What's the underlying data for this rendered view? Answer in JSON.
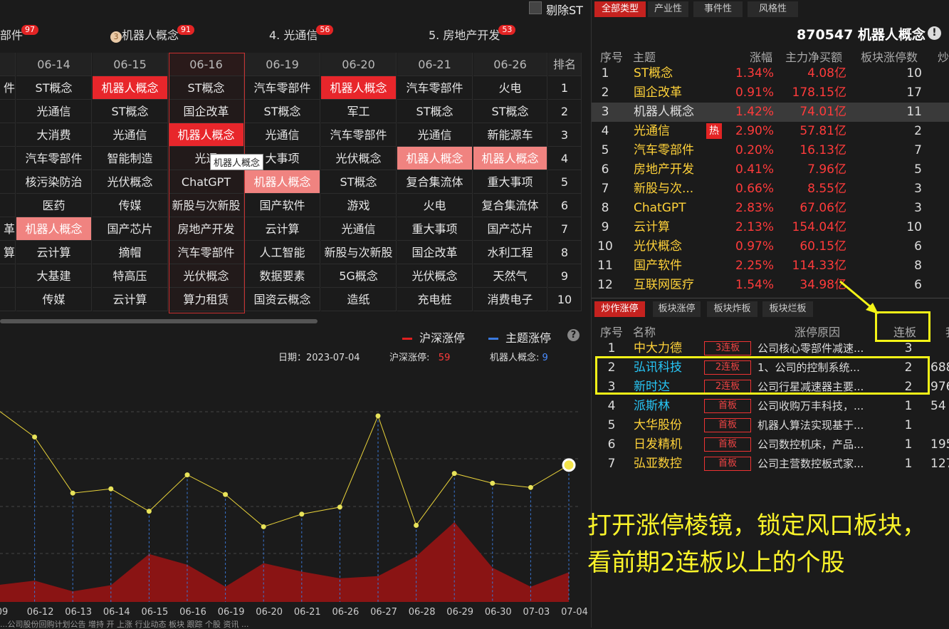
{
  "top_ranks": [
    {
      "label": "部件",
      "badge": "97"
    },
    {
      "label": "机器人概念",
      "badge": "91",
      "icon": "3"
    },
    {
      "label": "4. 光通信",
      "badge": "56"
    },
    {
      "label": "5. 房地产开发",
      "badge": "53"
    }
  ],
  "checkbox_label": "剔除ST",
  "grid": {
    "dates": [
      "06-14",
      "06-15",
      "06-16",
      "06-19",
      "06-20",
      "06-21",
      "06-26"
    ],
    "rank_header": "排名",
    "left_partial": [
      "",
      "件",
      "",
      "",
      "",
      "",
      "",
      "革",
      "算",
      "",
      ""
    ],
    "rows": [
      [
        "ST概念",
        "机器人概念",
        "ST概念",
        "汽车零部件",
        "机器人概念",
        "汽车零部件",
        "火电",
        "1"
      ],
      [
        "光通信",
        "ST概念",
        "国企改革",
        "ST概念",
        "军工",
        "ST概念",
        "ST概念",
        "2"
      ],
      [
        "大消费",
        "光通信",
        "机器人概念",
        "光通信",
        "汽车零部件",
        "光通信",
        "新能源车",
        "3"
      ],
      [
        "汽车零部件",
        "智能制造",
        "光通",
        "大事项",
        "光伏概念",
        "机器人概念",
        "机器人概念",
        "4"
      ],
      [
        "核污染防治",
        "光伏概念",
        "ChatGPT",
        "机器人概念",
        "ST概念",
        "复合集流体",
        "重大事项",
        "5"
      ],
      [
        "医药",
        "传媒",
        "新股与次新股",
        "国产软件",
        "游戏",
        "火电",
        "复合集流体",
        "6"
      ],
      [
        "机器人概念",
        "国产芯片",
        "房地产开发",
        "云计算",
        "光通信",
        "重大事项",
        "国产芯片",
        "7"
      ],
      [
        "云计算",
        "摘帽",
        "汽车零部件",
        "人工智能",
        "新股与次新股",
        "国企改革",
        "水利工程",
        "8"
      ],
      [
        "大基建",
        "特高压",
        "光伏概念",
        "数据要素",
        "5G概念",
        "光伏概念",
        "天然气",
        "9"
      ],
      [
        "传媒",
        "云计算",
        "算力租赁",
        "国资云概念",
        "造纸",
        "充电桩",
        "消费电子",
        "10"
      ]
    ],
    "tooltip": "机器人概念"
  },
  "chart_legend": {
    "a": "沪深涨停",
    "b": "主题涨停"
  },
  "chart_info": {
    "date_label": "日期：",
    "date": "2023-07-04",
    "hs_label": "沪深涨停:",
    "hs_value": "59",
    "theme_label": "机器人概念:",
    "theme_value": "9"
  },
  "chart_data": {
    "type": "line",
    "x": [
      "09",
      "06-12",
      "06-13",
      "06-14",
      "06-15",
      "06-16",
      "06-19",
      "06-20",
      "06-21",
      "06-26",
      "06-27",
      "06-28",
      "06-29",
      "06-30",
      "07-03",
      "07-04"
    ],
    "series": [
      {
        "name": "主题涨停",
        "values": [
          13,
          11,
          7,
          7.3,
          5.7,
          8.3,
          6.9,
          4.6,
          5.5,
          6,
          12.5,
          4.7,
          8.4,
          7.7,
          7.4,
          9
        ]
      },
      {
        "name": "沪深涨停",
        "values": [
          22,
          28,
          14,
          22,
          63,
          49,
          20,
          51,
          40,
          31,
          34,
          60,
          105,
          45,
          20,
          39
        ]
      }
    ]
  },
  "right": {
    "tabs": [
      "全部类型",
      "产业性",
      "事件性",
      "风格性"
    ],
    "title": "870547 机器人概念",
    "headers": [
      "序号",
      "主题",
      "涨幅",
      "主力净买额",
      "板块涨停数",
      "炒"
    ],
    "rows": [
      [
        "1",
        "ST概念",
        "1.34%",
        "4.08亿",
        "10"
      ],
      [
        "2",
        "国企改革",
        "0.91%",
        "178.15亿",
        "17"
      ],
      [
        "3",
        "机器人概念",
        "1.42%",
        "74.01亿",
        "11"
      ],
      [
        "4",
        "光通信",
        "2.90%",
        "57.81亿",
        "2"
      ],
      [
        "5",
        "汽车零部件",
        "0.20%",
        "16.13亿",
        "7"
      ],
      [
        "6",
        "房地产开发",
        "0.41%",
        "7.96亿",
        "5"
      ],
      [
        "7",
        "新股与次...",
        "0.66%",
        "8.55亿",
        "3"
      ],
      [
        "8",
        "ChatGPT",
        "2.83%",
        "67.06亿",
        "3"
      ],
      [
        "9",
        "云计算",
        "2.13%",
        "154.04亿",
        "10"
      ],
      [
        "10",
        "光伏概念",
        "0.97%",
        "60.15亿",
        "6"
      ],
      [
        "11",
        "国产软件",
        "2.25%",
        "114.33亿",
        "8"
      ],
      [
        "12",
        "互联网医疗",
        "1.54%",
        "34.98亿",
        "6"
      ]
    ],
    "hot_label": "热",
    "tabs2": [
      "炒作涨停",
      "板块涨停",
      "板块炸板",
      "板块烂板"
    ],
    "headers2": [
      "序号",
      "名称",
      "涨停原因",
      "连板",
      "我"
    ],
    "stocks": [
      [
        "1",
        "中大力德",
        "3连板",
        "公司核心零部件减速...",
        "3",
        ""
      ],
      [
        "2",
        "弘讯科技",
        "2连板",
        "1、公司的控制系统...",
        "2",
        "688"
      ],
      [
        "3",
        "新时达",
        "2连板",
        "公司行星减速器主要...",
        "2",
        "976"
      ],
      [
        "4",
        "派斯林",
        "首板",
        "公司收购万丰科技，...",
        "1",
        "54"
      ],
      [
        "5",
        "大华股份",
        "首板",
        "机器人算法实现基于...",
        "1",
        ""
      ],
      [
        "6",
        "日发精机",
        "首板",
        "公司数控机床，产品...",
        "1",
        "195"
      ],
      [
        "7",
        "弘亚数控",
        "首板",
        "公司主营数控板式家...",
        "1",
        "127"
      ]
    ]
  },
  "annotation": "打开涨停棱镜，锁定风口板块，看前期2连板以上的个股",
  "ticker": "...公司股份回购计划公告 增持 开 上涨 行业动态 板块 跟踪 个股 资讯 ..."
}
